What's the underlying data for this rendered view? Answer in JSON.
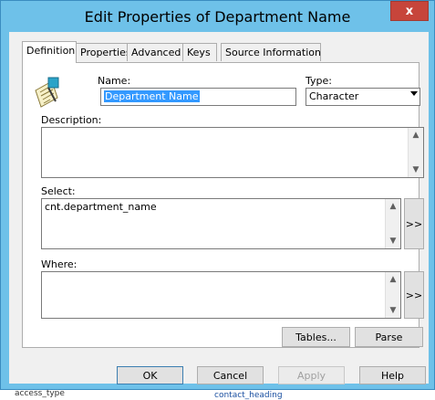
{
  "window": {
    "title": "Edit Properties of Department Name",
    "close_symbol": "x"
  },
  "tabs": [
    {
      "label": "Definition",
      "active": true
    },
    {
      "label": "Properties",
      "active": false
    },
    {
      "label": "Advanced",
      "active": false
    },
    {
      "label": "Keys",
      "active": false
    },
    {
      "label": "Source Information",
      "active": false
    }
  ],
  "form": {
    "name_label": "Name:",
    "name_value": "Department Name",
    "type_label": "Type:",
    "type_value": "Character",
    "description_label": "Description:",
    "description_value": "",
    "select_label": "Select:",
    "select_value": "cnt.department_name",
    "where_label": "Where:",
    "where_value": "",
    "expand_label": ">>"
  },
  "panel_buttons": {
    "tables": "Tables...",
    "parse": "Parse"
  },
  "footer_buttons": {
    "ok": "OK",
    "cancel": "Cancel",
    "apply": "Apply",
    "help": "Help"
  },
  "background_window": {
    "left_text": "access_type",
    "right_text": "contact_heading"
  },
  "icons": {
    "item_icon": "edit-item-icon",
    "scroll_up": "arrow-up-icon",
    "scroll_down": "arrow-down-icon",
    "dropdown": "chevron-down-icon"
  }
}
